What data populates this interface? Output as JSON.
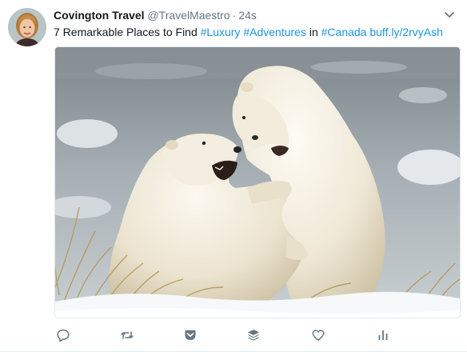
{
  "tweet": {
    "display_name": "Covington Travel",
    "handle": "@TravelMaestro",
    "separator": "·",
    "timestamp": "24s",
    "text_parts": {
      "intro": "7 Remarkable Places to Find ",
      "hashtag1": "#Luxury",
      "space1": " ",
      "hashtag2": "#Adventures",
      "in_word": " in ",
      "hashtag3": "#Canada",
      "space2": " ",
      "url": "buff.ly/2rvyAsh"
    },
    "media_alt": "Two polar bears sparring in the snow"
  },
  "actions": [
    {
      "icon": "reply-icon"
    },
    {
      "icon": "retweet-icon"
    },
    {
      "icon": "pocket-icon"
    },
    {
      "icon": "buffer-icon"
    },
    {
      "icon": "like-icon"
    },
    {
      "icon": "analytics-icon"
    }
  ],
  "colors": {
    "link": "#1b95e0",
    "muted": "#657786",
    "icon": "#657786",
    "text": "#14171a"
  }
}
